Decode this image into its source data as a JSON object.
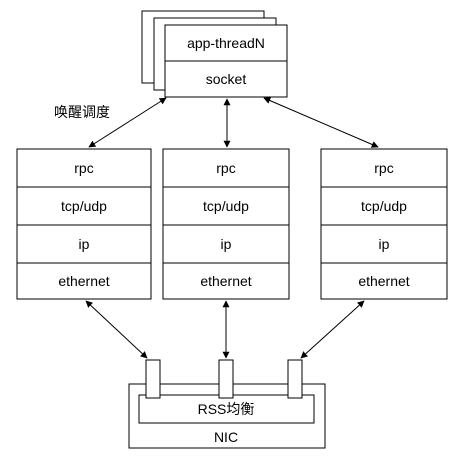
{
  "app": {
    "thread_label": "app-threadN",
    "socket_label": "socket"
  },
  "wake_label": "唤醒调度",
  "stacks": [
    {
      "layers": [
        "rpc",
        "tcp/udp",
        "ip",
        "ethernet"
      ]
    },
    {
      "layers": [
        "rpc",
        "tcp/udp",
        "ip",
        "ethernet"
      ]
    },
    {
      "layers": [
        "rpc",
        "tcp/udp",
        "ip",
        "ethernet"
      ]
    }
  ],
  "nic": {
    "rss_label": "RSS均衡",
    "nic_label": "NIC"
  }
}
